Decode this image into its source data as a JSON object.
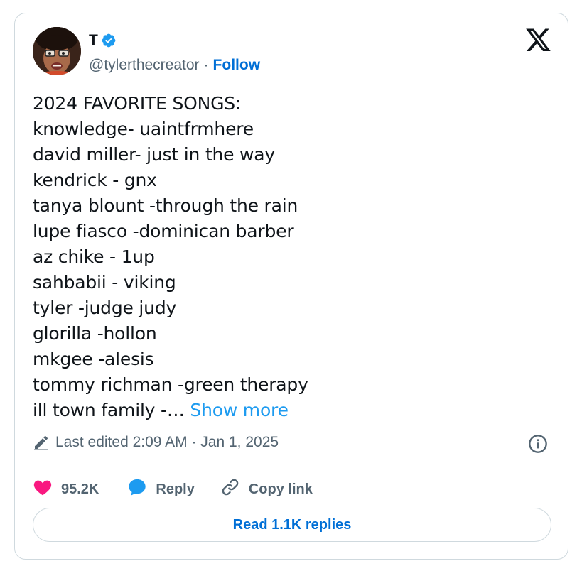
{
  "author": {
    "display_name": "T",
    "handle": "@tylerthecreator",
    "separator": "·",
    "follow_label": "Follow"
  },
  "tweet": {
    "lines": [
      "2024 FAVORITE SONGS:",
      "knowledge- uaintfrmhere",
      "david miller- just in the way",
      "kendrick - gnx",
      "tanya blount -through the rain",
      "lupe fiasco -dominican barber",
      "az chike - 1up",
      "sahbabii - viking",
      "tyler -judge judy",
      "glorilla -hollon",
      "mkgee -alesis",
      "tommy richman -green therapy",
      "ill town family -…"
    ],
    "show_more_label": "Show more",
    "edited_text": "Last edited 2:09 AM · Jan 1, 2025"
  },
  "actions": {
    "likes_count": "95.2K",
    "reply_label": "Reply",
    "copy_link_label": "Copy link",
    "read_replies_label": "Read 1.1K replies"
  },
  "icons": {
    "verified": "verified-badge-icon",
    "brand": "x-logo-icon",
    "pencil": "pencil-icon",
    "info": "info-icon",
    "like": "heart-icon",
    "reply": "reply-bubble-icon",
    "link": "link-icon"
  },
  "colors": {
    "link_blue": "#006fd6",
    "show_more_blue": "#1d9bf0",
    "verified_blue": "#1d9bf0",
    "like_pink": "#f91880",
    "reply_blue": "#1d9bf0",
    "muted_text": "#536471",
    "border": "#cfd9de"
  }
}
